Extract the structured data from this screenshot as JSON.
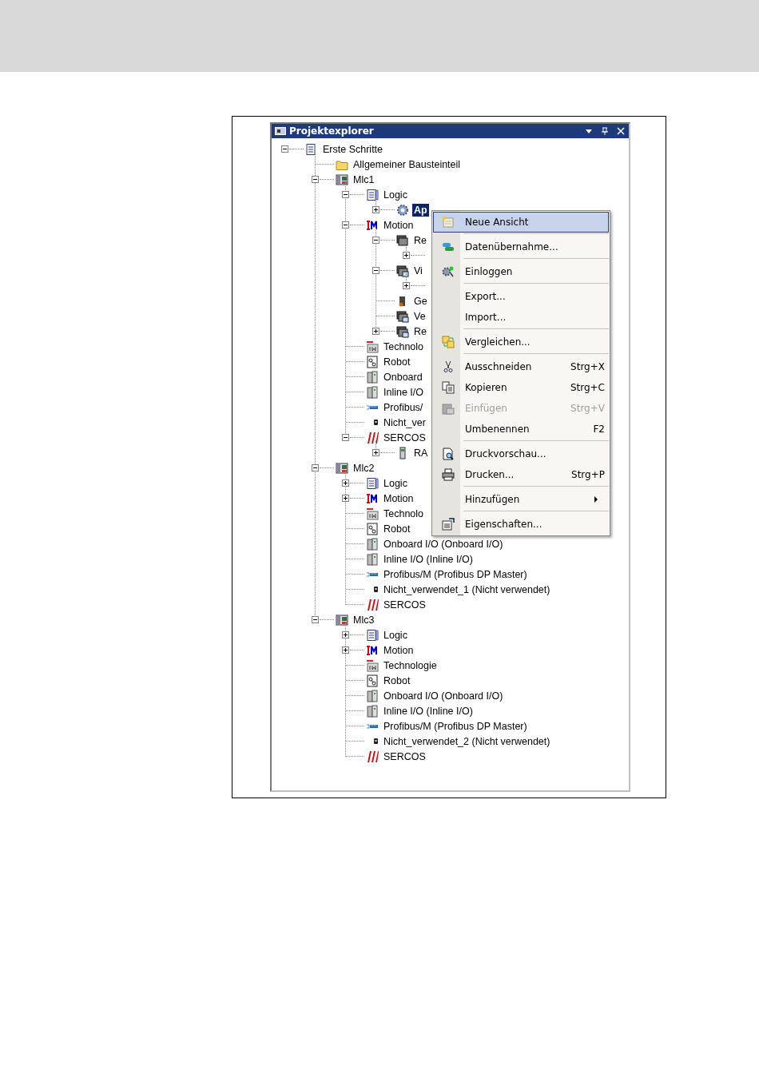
{
  "window": {
    "title": "Projektexplorer"
  },
  "tree": [
    {
      "label": "Erste Schritte",
      "kind": "project",
      "expanded": true,
      "selected": false,
      "children": [
        {
          "label": "Allgemeiner Bausteinteil",
          "kind": "folder",
          "selected": false
        },
        {
          "label": "Mlc1",
          "kind": "controller",
          "expanded": true,
          "selected": false,
          "children": [
            {
              "label": "Logic",
              "kind": "logic",
              "expanded": true,
              "selected": false,
              "children": [
                {
                  "label": "Ap",
                  "kind": "gear",
                  "expanded": false,
                  "selected": true
                }
              ]
            },
            {
              "label": "Motion",
              "kind": "motion",
              "expanded": true,
              "selected": false,
              "children": [
                {
                  "label": "Re",
                  "kind": "drive",
                  "expanded": true,
                  "selected": false,
                  "children": [
                    {
                      "expanded": false
                    }
                  ]
                },
                {
                  "label": "Vi",
                  "kind": "drive-virtual",
                  "expanded": true,
                  "selected": false,
                  "children": [
                    {
                      "expanded": false
                    }
                  ]
                },
                {
                  "label": "Ge",
                  "kind": "encoder",
                  "selected": false
                },
                {
                  "label": "Ve",
                  "kind": "drive-link",
                  "selected": false
                },
                {
                  "label": "Re",
                  "kind": "drive-virtual",
                  "expanded": false,
                  "selected": false
                }
              ]
            },
            {
              "label": "Technolo",
              "kind": "technology",
              "selected": false
            },
            {
              "label": "Robot",
              "kind": "robot",
              "selected": false
            },
            {
              "label": "Onboard",
              "kind": "io",
              "selected": false
            },
            {
              "label": "Inline I/O",
              "kind": "io",
              "selected": false
            },
            {
              "label": "Profibus/",
              "kind": "bus",
              "selected": false
            },
            {
              "label": "Nicht_ver",
              "kind": "plug",
              "selected": false
            },
            {
              "label": "SERCOS",
              "kind": "sercos",
              "expanded": true,
              "selected": false,
              "children": [
                {
                  "label": "RA",
                  "kind": "device",
                  "expanded": false,
                  "selected": false
                }
              ]
            }
          ]
        },
        {
          "label": "Mlc2",
          "kind": "controller",
          "expanded": true,
          "selected": false,
          "children": [
            {
              "label": "Logic",
              "kind": "logic",
              "expanded": false,
              "selected": false
            },
            {
              "label": "Motion",
              "kind": "motion",
              "expanded": false,
              "selected": false
            },
            {
              "label": "Technolo",
              "kind": "technology",
              "selected": false
            },
            {
              "label": "Robot",
              "kind": "robot",
              "selected": false
            },
            {
              "label": "Onboard I/O (Onboard I/O)",
              "kind": "io",
              "selected": false
            },
            {
              "label": "Inline I/O (Inline I/O)",
              "kind": "io",
              "selected": false
            },
            {
              "label": "Profibus/M (Profibus DP Master)",
              "kind": "bus",
              "selected": false
            },
            {
              "label": "Nicht_verwendet_1 (Nicht verwendet)",
              "kind": "plug",
              "selected": false
            },
            {
              "label": "SERCOS",
              "kind": "sercos",
              "selected": false
            }
          ]
        },
        {
          "label": "Mlc3",
          "kind": "controller",
          "expanded": true,
          "selected": false,
          "children": [
            {
              "label": "Logic",
              "kind": "logic",
              "expanded": false,
              "selected": false
            },
            {
              "label": "Motion",
              "kind": "motion",
              "expanded": false,
              "selected": false
            },
            {
              "label": "Technologie",
              "kind": "technology",
              "selected": false
            },
            {
              "label": "Robot",
              "kind": "robot",
              "selected": false
            },
            {
              "label": "Onboard I/O (Onboard I/O)",
              "kind": "io",
              "selected": false
            },
            {
              "label": "Inline I/O (Inline I/O)",
              "kind": "io",
              "selected": false
            },
            {
              "label": "Profibus/M (Profibus DP Master)",
              "kind": "bus",
              "selected": false
            },
            {
              "label": "Nicht_verwendet_2 (Nicht verwendet)",
              "kind": "plug",
              "selected": false
            },
            {
              "label": "SERCOS",
              "kind": "sercos",
              "selected": false
            }
          ]
        }
      ]
    }
  ],
  "context_menu": [
    [
      {
        "label": "Neue Ansicht",
        "kind": "new-view",
        "selected": true,
        "disabled": false,
        "submenu": false
      }
    ],
    [
      {
        "label": "Datenübernahme...",
        "kind": "transfer",
        "selected": false,
        "disabled": false,
        "submenu": false
      }
    ],
    [
      {
        "label": "Einloggen",
        "kind": "login",
        "selected": false,
        "disabled": false,
        "submenu": false
      }
    ],
    [
      {
        "label": "Export...",
        "selected": false,
        "disabled": false,
        "submenu": false
      },
      {
        "label": "Import...",
        "selected": false,
        "disabled": false,
        "submenu": false
      }
    ],
    [
      {
        "label": "Vergleichen...",
        "kind": "compare",
        "selected": false,
        "disabled": false,
        "submenu": false
      }
    ],
    [
      {
        "label": "Ausschneiden",
        "shortcut": "Strg+X",
        "kind": "cut",
        "selected": false,
        "disabled": false,
        "submenu": false
      },
      {
        "label": "Kopieren",
        "shortcut": "Strg+C",
        "kind": "copy",
        "selected": false,
        "disabled": false,
        "submenu": false
      },
      {
        "label": "Einfügen",
        "shortcut": "Strg+V",
        "kind": "paste",
        "selected": false,
        "disabled": true,
        "submenu": false
      },
      {
        "label": "Umbenennen",
        "shortcut": "F2",
        "selected": false,
        "disabled": false,
        "submenu": false
      }
    ],
    [
      {
        "label": "Druckvorschau...",
        "kind": "preview",
        "selected": false,
        "disabled": false,
        "submenu": false
      },
      {
        "label": "Drucken...",
        "shortcut": "Strg+P",
        "kind": "print",
        "selected": false,
        "disabled": false,
        "submenu": false
      }
    ],
    [
      {
        "label": "Hinzufügen",
        "selected": false,
        "disabled": false,
        "submenu": true
      }
    ],
    [
      {
        "label": "Eigenschaften...",
        "kind": "properties",
        "selected": false,
        "disabled": false,
        "submenu": false
      }
    ]
  ]
}
